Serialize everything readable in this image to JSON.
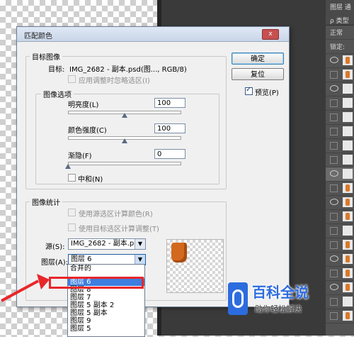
{
  "dialog": {
    "title": "匹配颜色",
    "close": "x"
  },
  "target_group": {
    "title": "目标图像",
    "target_label": "目标:",
    "target_value": "IMG_2682 - 副本.psd(图..., RGB/8)",
    "ignore_selection_label": "应用调整时忽略选区(I)"
  },
  "image_options": {
    "title": "图像选项",
    "luminance_label": "明亮度(L)",
    "luminance_value": "100",
    "color_intensity_label": "颜色强度(C)",
    "color_intensity_value": "100",
    "fade_label": "渐隐(F)",
    "fade_value": "0",
    "neutralize_label": "中和(N)"
  },
  "buttons": {
    "ok": "确定",
    "reset": "复位",
    "preview_label": "预览(P)"
  },
  "image_stats": {
    "title": "图像统计",
    "use_source_selection": "使用源选区计算颜色(R)",
    "use_target_selection": "使用目标选区计算调整(T)",
    "source_label": "源(S):",
    "source_value": "IMG_2682 - 副本.psd",
    "layer_label": "图层(A):",
    "layer_value": "图层 6"
  },
  "layer_dropdown": {
    "options": [
      "合并的",
      "图层 6",
      "图层 8",
      "图层 7",
      "图层 5 副本 2",
      "图层 5 副本",
      "图层 9",
      "图层 5"
    ],
    "selected": "图层 6"
  },
  "layers_panel": {
    "tab": "图层",
    "tab2": "通",
    "search": "ρ 类型",
    "blend": "正常",
    "lock": "锁定:"
  },
  "watermark": {
    "title": "百科全说",
    "subtitle": "助你轻松解决"
  },
  "colors": {
    "highlight": "#e8262a",
    "selection": "#3d7ee0",
    "brand": "#2d6cdf"
  }
}
